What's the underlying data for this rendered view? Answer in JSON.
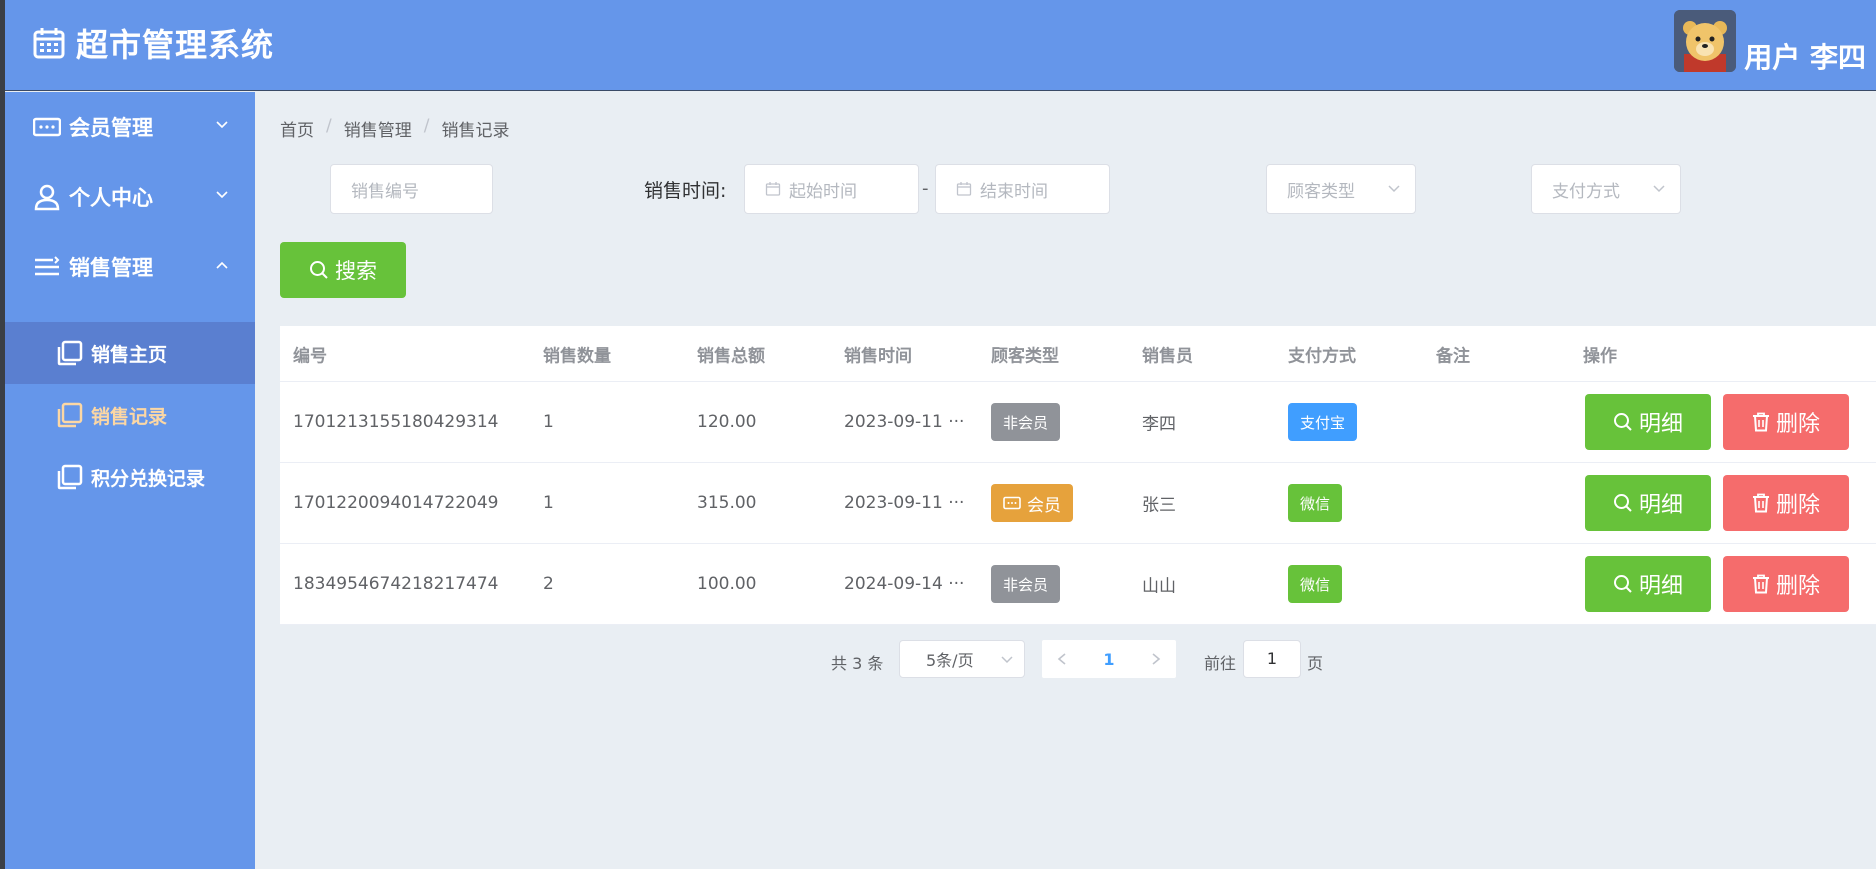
{
  "app": {
    "title": "超市管理系统",
    "user_name": "用户 李四"
  },
  "sidebar": {
    "menus": [
      {
        "label": "会员管理",
        "icon": "member-card-icon",
        "expanded": false
      },
      {
        "label": "个人中心",
        "icon": "user-icon",
        "expanded": false
      },
      {
        "label": "销售管理",
        "icon": "list-icon",
        "expanded": true
      }
    ],
    "submenu": [
      {
        "label": "销售主页"
      },
      {
        "label": "销售记录"
      },
      {
        "label": "积分兑换记录"
      }
    ]
  },
  "breadcrumb": [
    "首页",
    "销售管理",
    "销售记录"
  ],
  "filters": {
    "sale_id_placeholder": "销售编号",
    "time_label": "销售时间:",
    "start_placeholder": "起始时间",
    "range_sep": "-",
    "end_placeholder": "结束时间",
    "customer_type_placeholder": "顾客类型",
    "payment_placeholder": "支付方式",
    "search_label": "搜索"
  },
  "table": {
    "headers": [
      "编号",
      "销售数量",
      "销售总额",
      "销售时间",
      "顾客类型",
      "销售员",
      "支付方式",
      "备注",
      "操作"
    ],
    "rows": [
      {
        "id": "1701213155180429314",
        "qty": "1",
        "total": "120.00",
        "time": "2023-09-11 ···",
        "customer_type": "非会员",
        "seller": "李四",
        "payment": "支付宝",
        "note": ""
      },
      {
        "id": "1701220094014722049",
        "qty": "1",
        "total": "315.00",
        "time": "2023-09-11 ···",
        "customer_type": "会员",
        "seller": "张三",
        "payment": "微信",
        "note": ""
      },
      {
        "id": "1834954674218217474",
        "qty": "2",
        "total": "100.00",
        "time": "2024-09-14 ···",
        "customer_type": "非会员",
        "seller": "山山",
        "payment": "微信",
        "note": ""
      }
    ],
    "detail_label": "明细",
    "delete_label": "删除"
  },
  "pagination": {
    "total": "共 3 条",
    "page_size": "5条/页",
    "current_page": "1",
    "goto_label": "前往",
    "goto_value": "1",
    "page_unit": "页"
  },
  "colors": {
    "primary_blue": "#6596ea",
    "success": "#67c23a",
    "danger": "#f56c6c",
    "warning": "#e6a23c",
    "info": "#909399",
    "link": "#409eff",
    "active_submenu_text": "#fcd7a4"
  }
}
